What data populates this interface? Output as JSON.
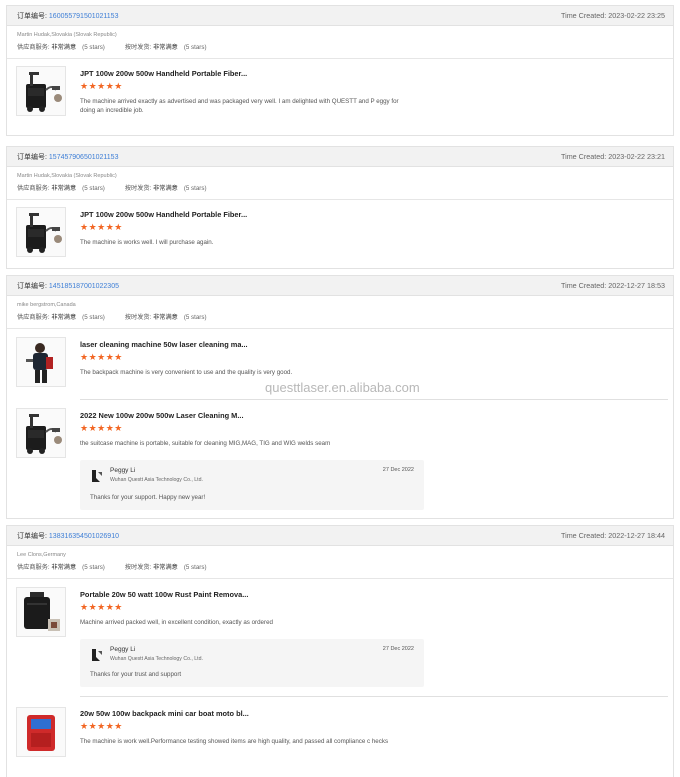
{
  "labels": {
    "order_no": "订单编号:",
    "time_created": "Time Created:",
    "supplier_service": "供应商服务:",
    "on_time_delivery": "按时发货:",
    "very_satisfied": "非常满意",
    "five_stars": "(5 stars)",
    "stars": "★★★★★"
  },
  "watermark": "questtlaser.en.alibaba.com",
  "orders": [
    {
      "order_no": "160055791501021153",
      "time": "2023-02-22 23:25",
      "buyer": "Martin Hudak,Slovakia (Slovak Republic)",
      "items": [
        {
          "title": "JPT 100w 200w 500w Handheld Portable Fiber...",
          "review": "The machine arrived exactly as advertised and was packaged very well. I am delighted with QUESTT and P eggy for doing an incredible job."
        }
      ]
    },
    {
      "order_no": "157457906501021153",
      "time": "2023-02-22 23:21",
      "buyer": "Martin Hudak,Slovakia (Slovak Republic)",
      "items": [
        {
          "title": "JPT 100w 200w 500w Handheld Portable Fiber...",
          "review": "The machine is works well. I will purchase again."
        }
      ]
    },
    {
      "order_no": "145185187001022305",
      "time": "2022-12-27 18:53",
      "buyer": "mike bergstrom,Canada",
      "items": [
        {
          "title": "laser cleaning machine 50w laser cleaning ma...",
          "review": "The backpack machine is very convenient to use and the quality is very good."
        },
        {
          "title": "2022 New 100w 200w 500w Laser Cleaning M...",
          "review": "the suitcase machine is portable, suitable for cleaning MIG,MAG, TIG and WIG welds seam",
          "reply": {
            "name": "Peggy Li",
            "company": "Wuhan Questt Asia Technology Co., Ltd.",
            "date": "27 Dec 2022",
            "text": "Thanks for your support. Happy new year!"
          }
        }
      ]
    },
    {
      "order_no": "138316354501026910",
      "time": "2022-12-27 18:44",
      "buyer": "Lee Clons,Germany",
      "items": [
        {
          "title": "Portable 20w 50 watt 100w Rust Paint Remova...",
          "review": "Machine arrived packed well, in excellent condition, exactly as ordered",
          "reply": {
            "name": "Peggy Li",
            "company": "Wuhan Questt Asia Technology Co., Ltd.",
            "date": "27 Dec 2022",
            "text": "Thanks for your trust and support"
          }
        },
        {
          "title": "20w 50w 100w backpack mini car boat moto bl...",
          "review": "The machine is work well.Performance testing showed items are high quality, and passed all compliance c hecks"
        }
      ]
    }
  ],
  "colors": {
    "link": "#3d7ed6",
    "star": "#f26522",
    "header_bg": "#f2f2f2"
  }
}
